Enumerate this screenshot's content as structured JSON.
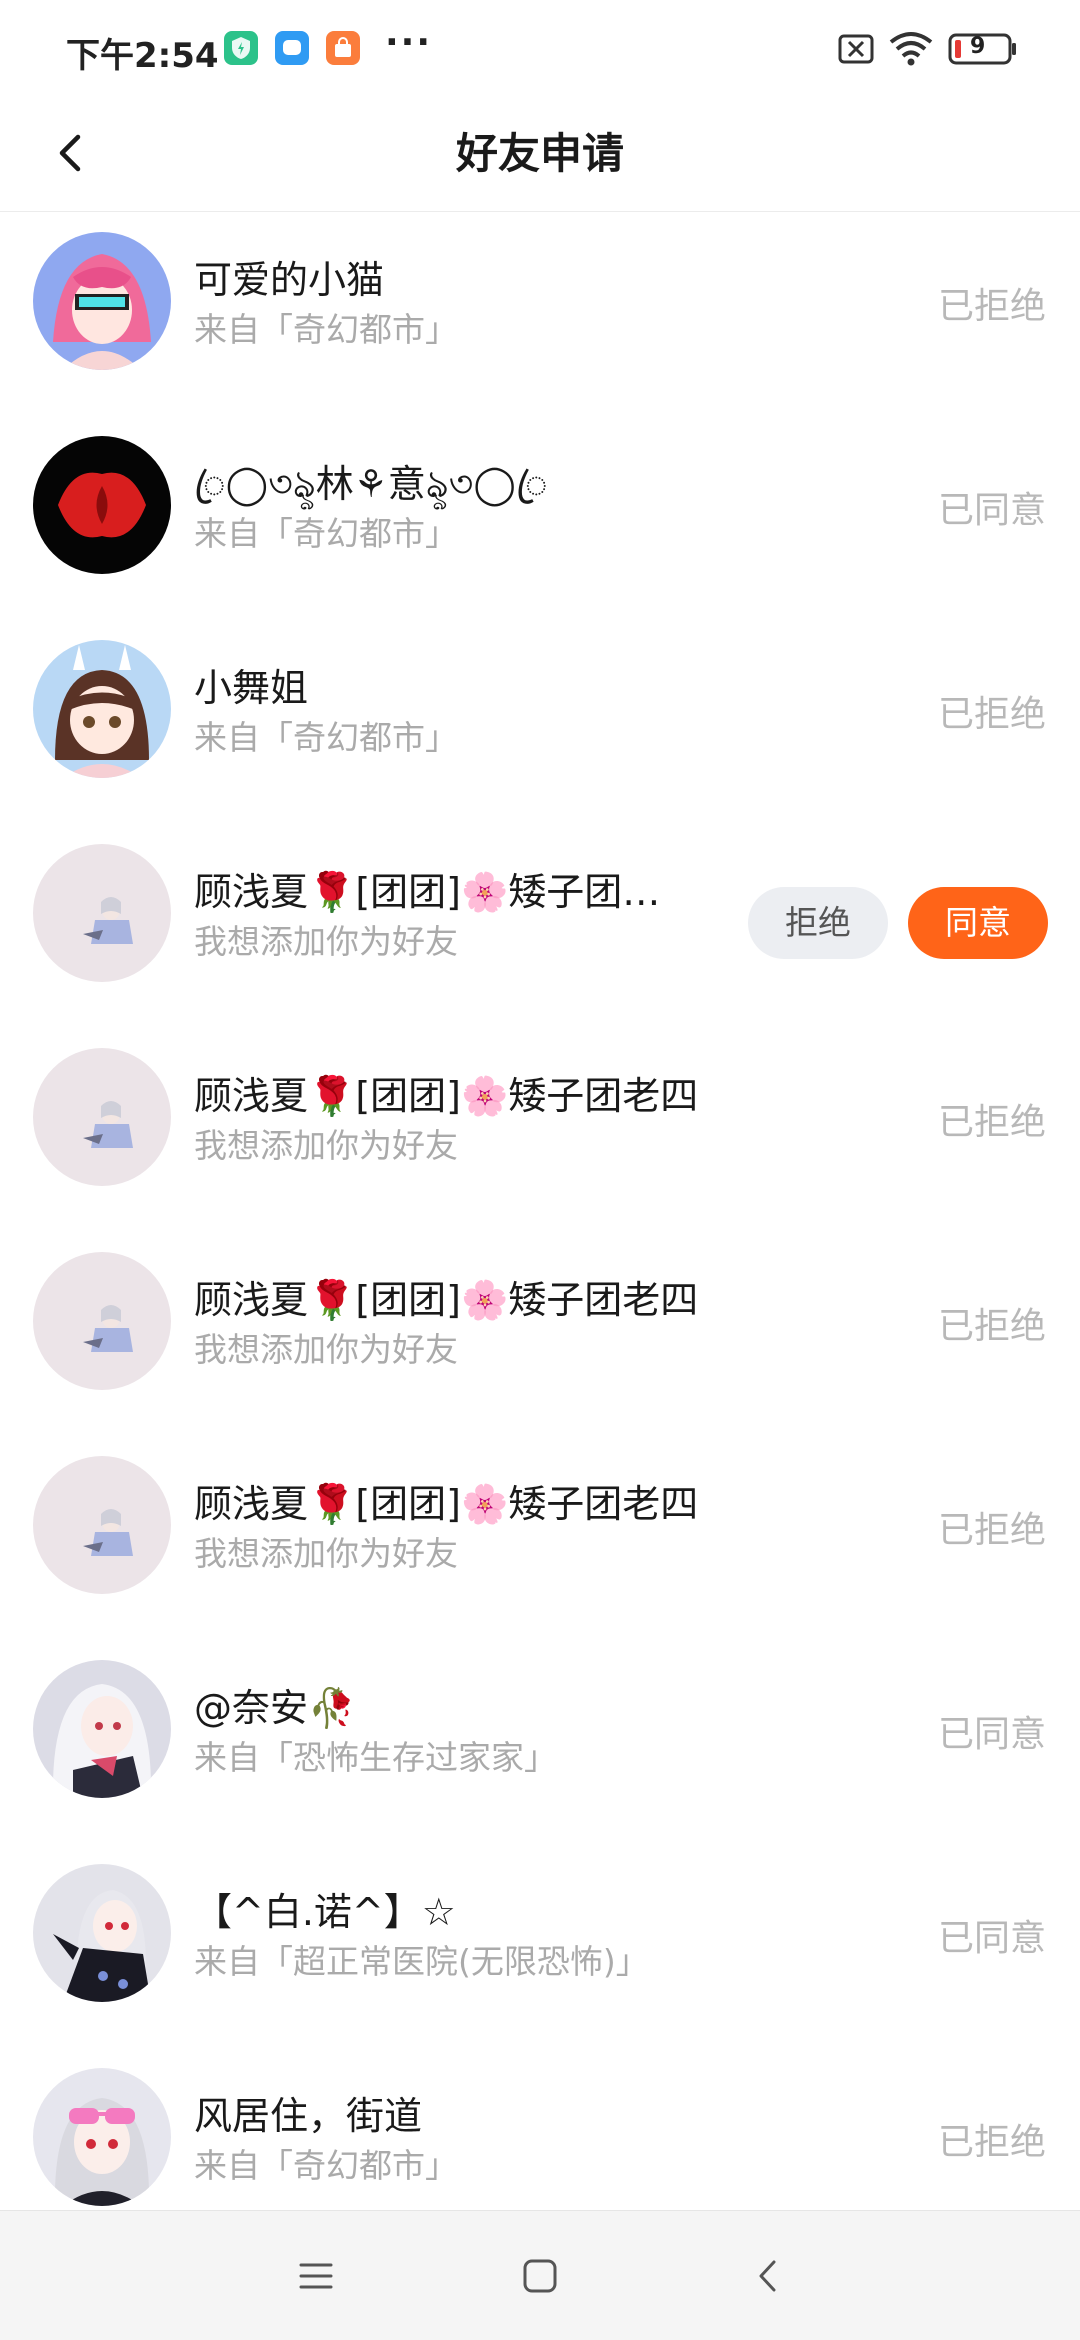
{
  "status_bar": {
    "time": "下午2:54",
    "more": "···",
    "battery": "9",
    "app_icons": [
      "shield-app-icon",
      "message-app-icon",
      "store-app-icon"
    ]
  },
  "header": {
    "title": "好友申请",
    "back_icon": "chevron-left-icon"
  },
  "requests": [
    {
      "name": "可爱的小猫",
      "source": "来自「奇幻都市」",
      "status": "已拒绝",
      "pending": false,
      "avatar": "pink-hair-girl"
    },
    {
      "name": "ꦿ◯৩ৡ林⚘意ৡ৩◯ꦿ",
      "source": "来自「奇幻都市」",
      "status": "已同意",
      "pending": false,
      "avatar": "red-shape-dark"
    },
    {
      "name": "小舞姐",
      "source": "来自「奇幻都市」",
      "status": "已拒绝",
      "pending": false,
      "avatar": "bunny-ear-girl"
    },
    {
      "name": "顾浅夏🌹[团团]🌸矮子团…",
      "source": "我想添加你为好友",
      "status": "",
      "pending": true,
      "reject_label": "拒绝",
      "accept_label": "同意",
      "avatar": "small-chibi"
    },
    {
      "name": "顾浅夏🌹[团团]🌸矮子团老四",
      "source": "我想添加你为好友",
      "status": "已拒绝",
      "pending": false,
      "avatar": "small-chibi"
    },
    {
      "name": "顾浅夏🌹[团团]🌸矮子团老四",
      "source": "我想添加你为好友",
      "status": "已拒绝",
      "pending": false,
      "avatar": "small-chibi"
    },
    {
      "name": "顾浅夏🌹[团团]🌸矮子团老四",
      "source": "我想添加你为好友",
      "status": "已拒绝",
      "pending": false,
      "avatar": "small-chibi"
    },
    {
      "name": "@奈安🥀",
      "source": "来自「恐怖生存过家家」",
      "status": "已同意",
      "pending": false,
      "avatar": "white-hair-girl"
    },
    {
      "name": "【^白.诺^】☆",
      "source": "来自「超正常医院(无限恐怖)」",
      "status": "已同意",
      "pending": false,
      "avatar": "dark-outfit-girl"
    },
    {
      "name": "风居住，街道",
      "source": "来自「奇幻都市」",
      "status": "已拒绝",
      "pending": false,
      "avatar": "sunglasses-girl"
    }
  ],
  "system_nav": [
    "menu-icon",
    "home-icon",
    "back-icon"
  ]
}
